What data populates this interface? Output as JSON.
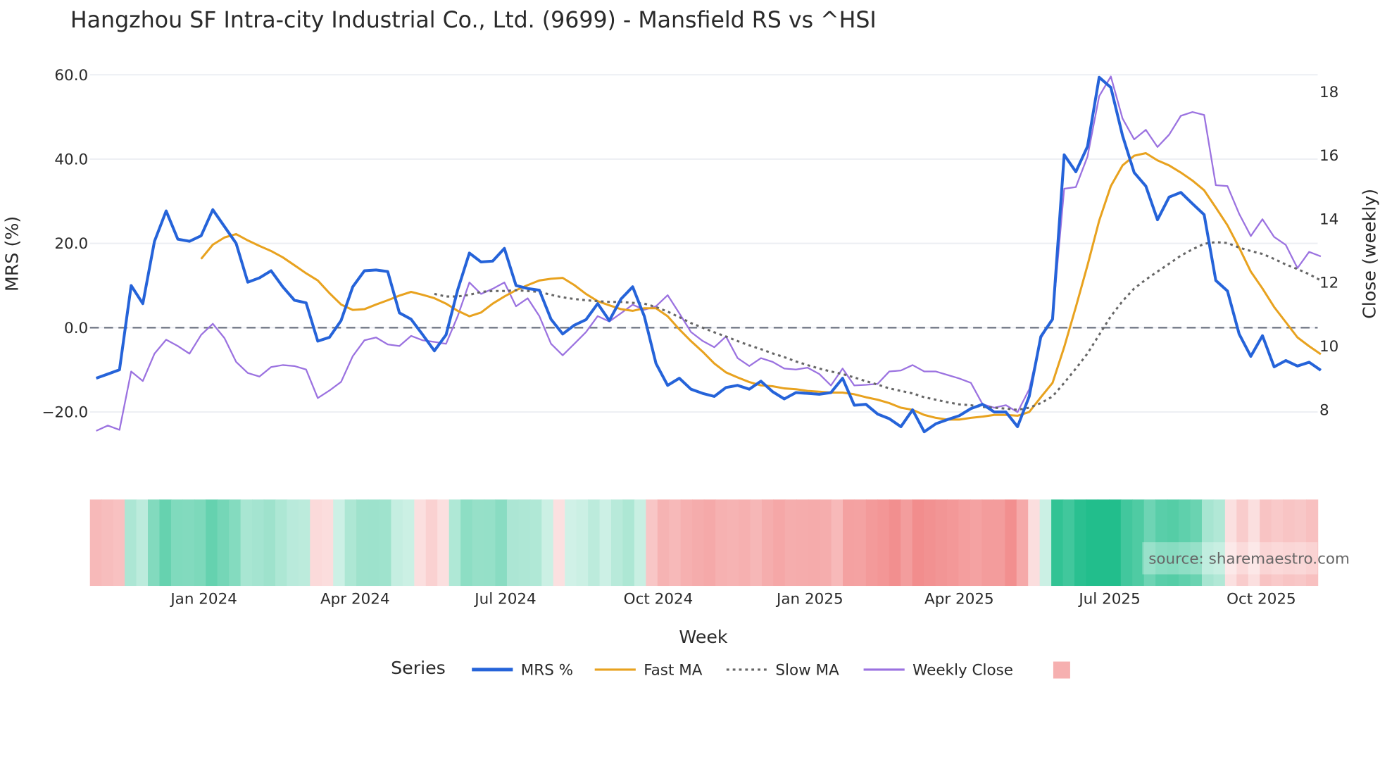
{
  "chart_data": {
    "type": "line",
    "title": "Hangzhou SF Intra-city Industrial Co., Ltd. (9699) - Mansfield RS vs ^HSI",
    "xlabel": "Week",
    "ylabel": "MRS (%)",
    "y2label": "Close (weekly)",
    "ylim": [
      -26,
      62
    ],
    "y2lim": [
      6.86,
      18.7
    ],
    "yticks": [
      "60.0",
      "40.0",
      "20.0",
      "0.0",
      "−20.0"
    ],
    "ytick_values": [
      60,
      40,
      20,
      0,
      -20
    ],
    "y2ticks": [
      "18",
      "16",
      "14",
      "12",
      "10",
      "8"
    ],
    "y2tick_values": [
      18,
      16,
      14,
      12,
      10,
      8
    ],
    "xticks": [
      {
        "label": "Jan 2024",
        "week": 9.24
      },
      {
        "label": "Apr 2024",
        "week": 22.2
      },
      {
        "label": "Jul 2024",
        "week": 35.1
      },
      {
        "label": "Oct 2024",
        "week": 48.2
      },
      {
        "label": "Jan 2025",
        "week": 61.2
      },
      {
        "label": "Apr 2025",
        "week": 74.0
      },
      {
        "label": "Jul 2025",
        "week": 86.9
      },
      {
        "label": "Oct 2025",
        "week": 99.9
      }
    ],
    "grid": true,
    "zero_line": true,
    "legend_title": "Series",
    "legend_position": "bottom",
    "series": [
      {
        "name": "MRS %",
        "axis": "left",
        "color": "#2563d9",
        "start": 0,
        "values": [
          -12,
          -11,
          -10,
          10,
          5.7,
          20.5,
          27.7,
          21,
          20.5,
          21.8,
          28,
          24,
          20,
          10.8,
          11.8,
          13.5,
          9.7,
          6.5,
          5.9,
          -3.2,
          -2.3,
          1.7,
          9.7,
          13.5,
          13.7,
          13.3,
          3.5,
          2,
          -1.7,
          -5.5,
          -1.7,
          9,
          17.7,
          15.6,
          15.8,
          18.8,
          10,
          9.3,
          8.9,
          2,
          -1.5,
          0.6,
          1.9,
          5.7,
          1.7,
          6.8,
          9.7,
          2.7,
          -8.5,
          -13.7,
          -12,
          -14.6,
          -15.6,
          -16.3,
          -14.2,
          -13.7,
          -14.6,
          -12.7,
          -15.2,
          -16.9,
          -15.4,
          -15.6,
          -15.8,
          -15.4,
          -12,
          -18.4,
          -18.2,
          -20.5,
          -21.6,
          -23.5,
          -19.5,
          -24.7,
          -22.8,
          -21.8,
          -20.9,
          -19.2,
          -18.2,
          -20,
          -20,
          -23.5,
          -16.3,
          -2.1,
          2,
          41,
          37,
          43,
          59.4,
          57,
          45.6,
          36.8,
          33.6,
          25.6,
          31,
          32.1,
          29.4,
          26.8,
          11.2,
          8.7,
          -1.5,
          -6.8,
          -1.9,
          -9.3,
          -7.8,
          -9.1,
          -8.2,
          -10.1
        ]
      },
      {
        "name": "Fast MA",
        "axis": "left",
        "color": "#e8a21f",
        "start": 9,
        "values": [
          16.3,
          19.7,
          21.4,
          22.2,
          20.7,
          19.4,
          18.2,
          16.7,
          14.8,
          12.9,
          11.2,
          8.2,
          5.5,
          4.2,
          4.4,
          5.5,
          6.5,
          7.6,
          8.5,
          7.8,
          7,
          5.7,
          4,
          2.7,
          3.6,
          5.7,
          7.4,
          8.9,
          10.1,
          11.2,
          11.6,
          11.8,
          10.1,
          8,
          6.3,
          5.3,
          4.4,
          4,
          4.6,
          4.6,
          2.7,
          -0.4,
          -3.2,
          -5.7,
          -8.5,
          -10.6,
          -11.8,
          -12.9,
          -13.7,
          -13.9,
          -14.4,
          -14.6,
          -15,
          -15.2,
          -15.4,
          -15.4,
          -15.8,
          -16.5,
          -17.1,
          -17.9,
          -19,
          -19.5,
          -20.7,
          -21.4,
          -21.8,
          -21.8,
          -21.4,
          -21.1,
          -20.7,
          -20.7,
          -20.9,
          -20,
          -16.5,
          -13.1,
          -4.6,
          4.9,
          14.8,
          25.4,
          33.6,
          38.5,
          40.8,
          41.4,
          39.7,
          38.5,
          36.8,
          34.9,
          32.6,
          28.5,
          24.3,
          19,
          13.3,
          9.3,
          4.9,
          1.3,
          -2.3,
          -4.4,
          -6.3
        ]
      },
      {
        "name": "Slow MA",
        "axis": "left",
        "color": "#666666",
        "dash": true,
        "start": 29,
        "values": [
          8,
          7.4,
          7.4,
          7.8,
          8.5,
          8.7,
          8.7,
          8.9,
          8.7,
          8.5,
          7.8,
          7.2,
          6.8,
          6.5,
          6.3,
          6.1,
          6.1,
          5.9,
          5.7,
          4.9,
          3.8,
          2.5,
          1.1,
          0,
          -1.1,
          -2.1,
          -3.2,
          -4.2,
          -5.1,
          -6.1,
          -7,
          -8,
          -8.9,
          -9.7,
          -10.4,
          -11,
          -11.8,
          -12.7,
          -13.5,
          -14.4,
          -15,
          -15.6,
          -16.5,
          -17.1,
          -17.7,
          -18.2,
          -18.4,
          -18.8,
          -19,
          -19.2,
          -19.5,
          -19,
          -17.9,
          -16.3,
          -13.1,
          -9.7,
          -6.1,
          -1.7,
          2.7,
          6.3,
          9.3,
          11.4,
          13.3,
          15.2,
          17.1,
          18.6,
          19.9,
          20.3,
          20.1,
          19,
          18.2,
          17.5,
          16.3,
          15,
          13.9,
          12.7,
          11.2
        ]
      },
      {
        "name": "Weekly Close",
        "axis": "right",
        "color": "#9b72e0",
        "start": 0,
        "values": [
          7.33,
          7.5,
          7.36,
          9.2,
          8.9,
          9.76,
          10.2,
          10,
          9.76,
          10.35,
          10.7,
          10.25,
          9.5,
          9.15,
          9.04,
          9.34,
          9.4,
          9.37,
          9.26,
          8.36,
          8.6,
          8.87,
          9.68,
          10.18,
          10.27,
          10.05,
          10,
          10.32,
          10.18,
          10.13,
          10.07,
          10.94,
          12,
          11.64,
          11.8,
          12,
          11.25,
          11.5,
          10.94,
          10.07,
          9.71,
          10.07,
          10.44,
          10.94,
          10.77,
          11.03,
          11.3,
          11.14,
          11.25,
          11.6,
          11.03,
          10.44,
          10.16,
          9.96,
          10.3,
          9.62,
          9.37,
          9.62,
          9.5,
          9.29,
          9.26,
          9.32,
          9.12,
          8.76,
          9.29,
          8.76,
          8.78,
          8.81,
          9.2,
          9.23,
          9.4,
          9.2,
          9.2,
          9.09,
          8.98,
          8.84,
          8.17,
          8.06,
          8.14,
          7.92,
          8.64,
          10.24,
          10.86,
          14.95,
          15,
          15.96,
          17.86,
          18.48,
          17.16,
          16.5,
          16.8,
          16.26,
          16.65,
          17.24,
          17.36,
          17.27,
          15.06,
          15.03,
          14.16,
          13.46,
          13.99,
          13.43,
          13.18,
          12.45,
          12.96,
          12.82
        ]
      }
    ],
    "heatmap": {
      "based_on": "MRS %",
      "positive_color": "#22be8c",
      "negative_color": "#f08080"
    },
    "annotation": "source: sharemaestro.com"
  }
}
